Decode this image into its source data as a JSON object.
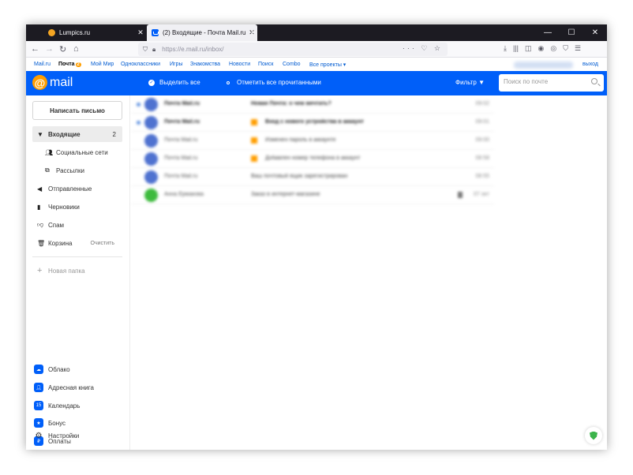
{
  "browser": {
    "tabs": [
      {
        "title": "Lumpics.ru",
        "close": "✕"
      },
      {
        "title": "(2) Входящие - Почта Mail.ru",
        "close": "✕"
      }
    ],
    "new_tab": "+",
    "window": {
      "minimize": "—",
      "maximize": "☐",
      "close": "✕"
    },
    "url": "https://e.mail.ru/inbox/"
  },
  "portal": {
    "links": [
      "Mail.ru",
      "Почта",
      "Мой Мир",
      "Одноклассники",
      "Игры",
      "Знакомства",
      "Новости",
      "Поиск",
      "Combo",
      "Все проекты ▾"
    ],
    "mail_badge": "2",
    "logout": "выход"
  },
  "header": {
    "logo_at": "@",
    "logo_text": "mail",
    "select_all": "Выделить все",
    "mark_read": "Отметить все прочитанными",
    "filter": "Фильтр ▼",
    "search_placeholder": "Поиск по почте"
  },
  "sidebar": {
    "compose": "Написать письмо",
    "inbox": {
      "label": "Входящие",
      "count": "2"
    },
    "social": "Социальные сети",
    "newsletters": "Рассылки",
    "sent": "Отправленные",
    "drafts": "Черновики",
    "spam": "Спам",
    "trash": "Корзина",
    "trash_clear": "Очистить",
    "new_folder": "Новая папка",
    "services": [
      "Облако",
      "Адресная книга",
      "Календарь",
      "Бонус",
      "Оплаты"
    ],
    "settings": "Настройки"
  },
  "messages": [
    {
      "sender": "Почта Mail.ru",
      "subject": "Новая Почта: о чем мечтать?",
      "date": "09:02"
    },
    {
      "sender": "Почта Mail.ru",
      "subject": "Вход с нового устройства в аккаунт",
      "date": "09:01"
    },
    {
      "sender": "Почта Mail.ru",
      "subject": "Изменен пароль в аккаунте",
      "date": "09:00"
    },
    {
      "sender": "Почта Mail.ru",
      "subject": "Добавлен номер телефона в аккаунт",
      "date": "08:58"
    },
    {
      "sender": "Почта Mail.ru",
      "subject": "Ваш почтовый ящик зарегистрирован",
      "date": "08:55"
    },
    {
      "sender": "Анна Ермакова",
      "subject": "Заказ в интернет-магазине",
      "date": "07 окт"
    }
  ],
  "colors": {
    "brand": "#005ff9",
    "accent": "#ff9e00"
  }
}
